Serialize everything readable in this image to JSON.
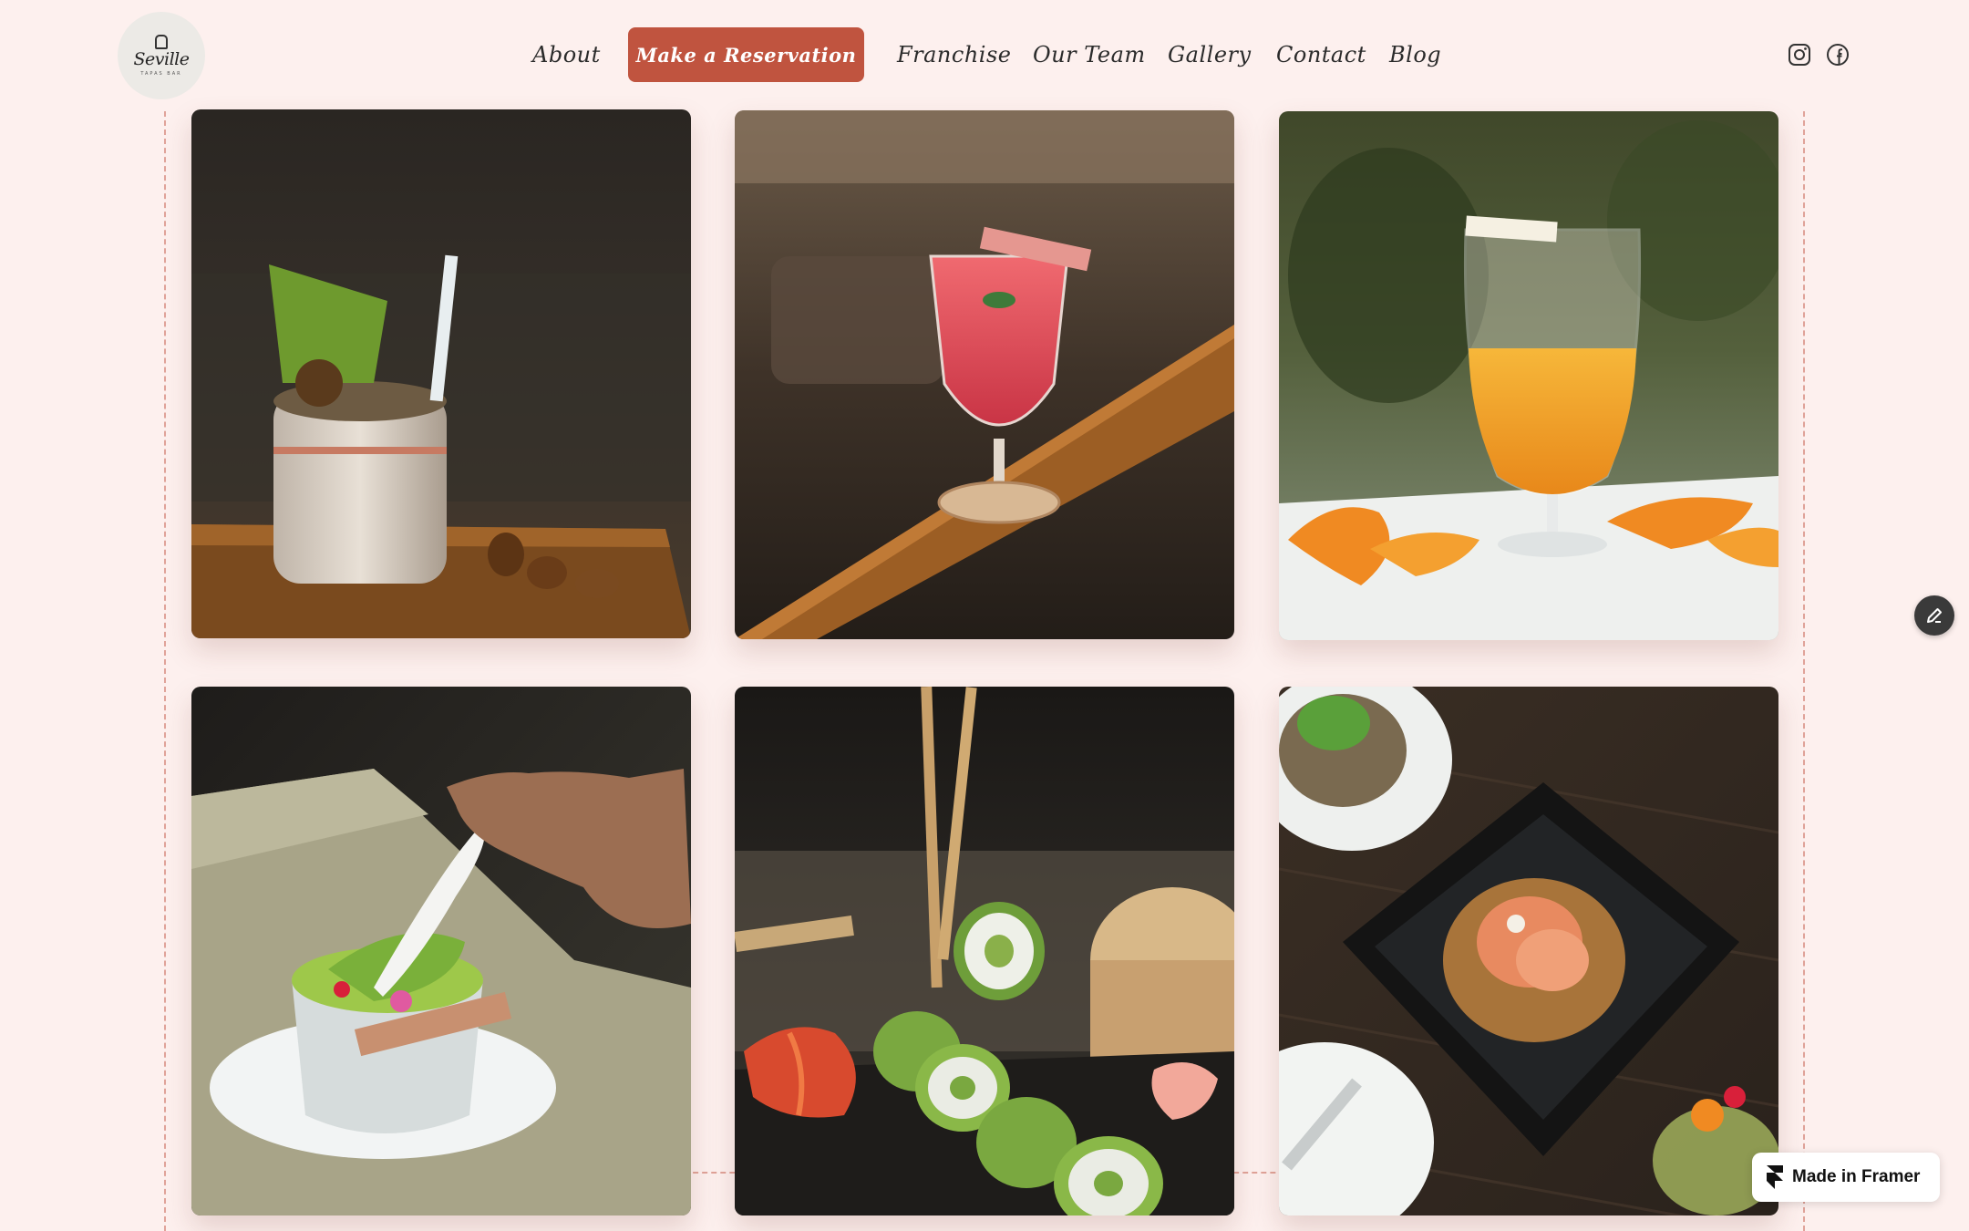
{
  "brand": {
    "logo_script": "Seville",
    "logo_tagline": "TAPAS BAR"
  },
  "nav": {
    "about": "About",
    "reservation": "Make a Reservation",
    "franchise": "Franchise",
    "team": "Our Team",
    "gallery": "Gallery",
    "contact": "Contact",
    "blog": "Blog"
  },
  "social": {
    "icons": [
      "instagram-icon",
      "facebook-icon"
    ]
  },
  "gallery": {
    "photos": [
      "cocktail-in-ceramic-cup",
      "red-cocktail-on-bar",
      "orange-cocktail-with-peels",
      "green-soup-with-spoon",
      "cucumber-sushi-rolls",
      "shrimp-on-black-plate"
    ]
  },
  "badge": {
    "label": "Made in Framer"
  },
  "colors": {
    "background": "#fdf0ee",
    "accent": "#c0543f",
    "text": "#2b2b2b"
  }
}
